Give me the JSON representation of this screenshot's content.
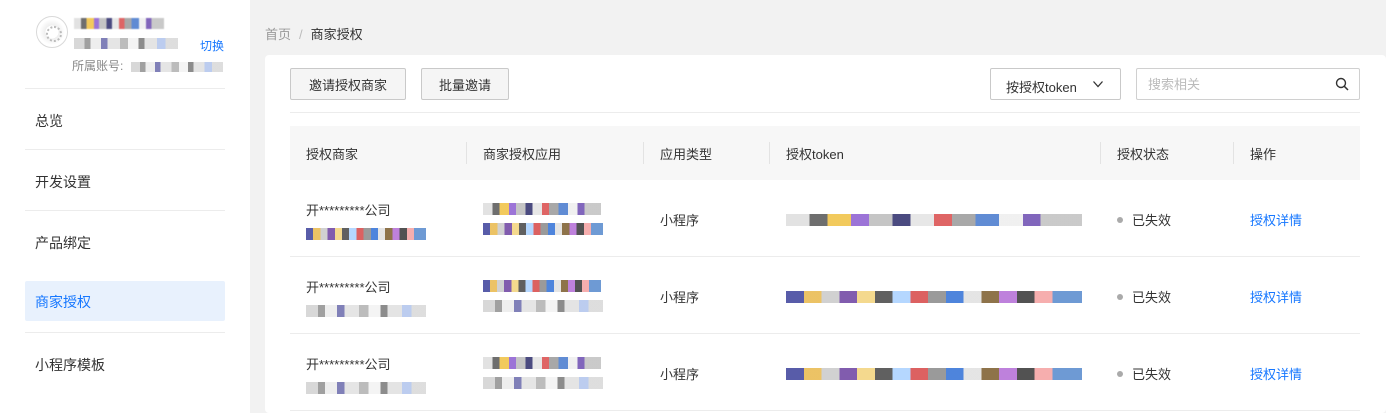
{
  "sidebar": {
    "profile": {
      "name": "...",
      "id": "...",
      "switch_label": "切换",
      "account_label": "所属账号:"
    },
    "menu": [
      {
        "label": "总览",
        "active": false
      },
      {
        "label": "开发设置",
        "active": false
      },
      {
        "label": "产品绑定",
        "active": false
      },
      {
        "label": "商家授权",
        "active": true
      },
      {
        "label": "小程序模板",
        "active": false
      }
    ]
  },
  "breadcrumb": {
    "home": "首页",
    "separator": "/",
    "current": "商家授权"
  },
  "toolbar": {
    "invite_label": "邀请授权商家",
    "batch_label": "批量邀请",
    "filter_select": "按授权token",
    "search_placeholder": "搜索相关"
  },
  "table": {
    "columns": [
      "授权商家",
      "商家授权应用",
      "应用类型",
      "授权token",
      "授权状态",
      "操作"
    ],
    "rows": [
      {
        "merchant": "开*********公司",
        "app_type": "小程序",
        "status": "已失效",
        "action": "授权详情"
      },
      {
        "merchant": "开*********公司",
        "app_type": "小程序",
        "status": "已失效",
        "action": "授权详情"
      },
      {
        "merchant": "开*********公司",
        "app_type": "小程序",
        "status": "已失效",
        "action": "授权详情"
      }
    ]
  },
  "colors": {
    "accent": "#1677ff",
    "active_bg": "#e8f1fd",
    "status_dot": "#aaaaaa"
  }
}
